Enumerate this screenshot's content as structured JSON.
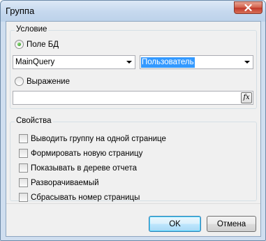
{
  "window": {
    "title": "Группа"
  },
  "condition": {
    "legend": "Условие",
    "field_radio_label": "Поле БД",
    "datasource_value": "MainQuery",
    "field_value": "Пользователь",
    "expression_radio_label": "Выражение",
    "expression_value": "",
    "fx_label": "fx"
  },
  "properties": {
    "legend": "Свойства",
    "items": [
      {
        "label": "Выводить группу на одной странице",
        "checked": false
      },
      {
        "label": "Формировать новую страницу",
        "checked": false
      },
      {
        "label": "Показывать в дереве отчета",
        "checked": false
      },
      {
        "label": "Разворачиваемый",
        "checked": false
      },
      {
        "label": "Сбрасывать номер страницы",
        "checked": false
      }
    ]
  },
  "buttons": {
    "ok": "OK",
    "cancel": "Отмена"
  }
}
